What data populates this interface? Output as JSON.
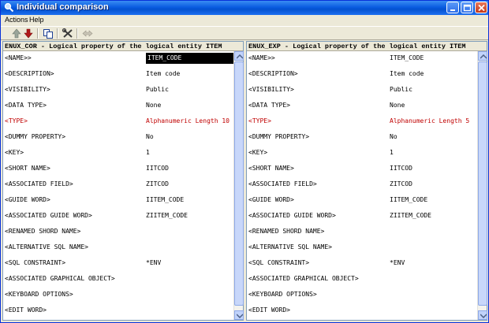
{
  "window": {
    "title": "Individual comparison"
  },
  "menu": [
    {
      "label": "Actions"
    },
    {
      "label": "Help"
    }
  ],
  "left_pane": {
    "header": "ENUX_COR - Logical property of the logical entity  ITEM",
    "rows": [
      {
        "name": "<NAME>>",
        "value": "ITEM_CODE",
        "selected": true
      },
      {
        "name": "<DESCRIPTION>",
        "value": "Item code"
      },
      {
        "name": "<VISIBILITY>",
        "value": "Public"
      },
      {
        "name": "<DATA TYPE>",
        "value": "None"
      },
      {
        "name": "<TYPE>",
        "value": "Alphanumeric Length 10",
        "highlight": true
      },
      {
        "name": "<DUMMY PROPERTY>",
        "value": "No"
      },
      {
        "name": "<KEY>",
        "value": "1"
      },
      {
        "name": "<SHORT NAME>",
        "value": "IITCOD"
      },
      {
        "name": "<ASSOCIATED FIELD>",
        "value": "ZITCOD"
      },
      {
        "name": "<GUIDE WORD>",
        "value": "IITEM_CODE"
      },
      {
        "name": "<ASSOCIATED GUIDE WORD>",
        "value": "ZIITEM_CODE"
      },
      {
        "name": "<RENAMED SHORD NAME>",
        "value": ""
      },
      {
        "name": "<ALTERNATIVE SQL NAME>",
        "value": ""
      },
      {
        "name": "<SQL CONSTRAINT>",
        "value": "*ENV"
      },
      {
        "name": "<ASSOCIATED GRAPHICAL OBJECT>",
        "value": ""
      },
      {
        "name": "<KEYBOARD OPTIONS>",
        "value": ""
      },
      {
        "name": "<EDIT WORD>",
        "value": ""
      }
    ]
  },
  "right_pane": {
    "header": "ENUX_EXP - Logical property of the logical entity  ITEM",
    "rows": [
      {
        "name": "<NAME>>",
        "value": "ITEM_CODE"
      },
      {
        "name": "<DESCRIPTION>",
        "value": "Item code"
      },
      {
        "name": "<VISIBILITY>",
        "value": "Public"
      },
      {
        "name": "<DATA TYPE>",
        "value": "None"
      },
      {
        "name": "<TYPE>",
        "value": "Alphanumeric Length 5",
        "highlight": true
      },
      {
        "name": "<DUMMY PROPERTY>",
        "value": "No"
      },
      {
        "name": "<KEY>",
        "value": "1"
      },
      {
        "name": "<SHORT NAME>",
        "value": "IITCOD"
      },
      {
        "name": "<ASSOCIATED FIELD>",
        "value": "ZITCOD"
      },
      {
        "name": "<GUIDE WORD>",
        "value": "IITEM_CODE"
      },
      {
        "name": "<ASSOCIATED GUIDE WORD>",
        "value": "ZIITEM_CODE"
      },
      {
        "name": "<RENAMED SHORD NAME>",
        "value": ""
      },
      {
        "name": "<ALTERNATIVE SQL NAME>",
        "value": ""
      },
      {
        "name": "<SQL CONSTRAINT>",
        "value": "*ENV"
      },
      {
        "name": "<ASSOCIATED GRAPHICAL OBJECT>",
        "value": ""
      },
      {
        "name": "<KEYBOARD OPTIONS>",
        "value": ""
      },
      {
        "name": "<EDIT WORD>",
        "value": ""
      }
    ]
  },
  "colors": {
    "highlight": "#c00000",
    "titlebar": "#0a5de0",
    "selection": "#000000"
  },
  "icons": [
    "search-icon",
    "minimize-icon",
    "maximize-icon",
    "close-icon",
    "arrow-up-icon",
    "arrow-down-icon",
    "copy-icon",
    "tools-icon",
    "swap-icon"
  ]
}
